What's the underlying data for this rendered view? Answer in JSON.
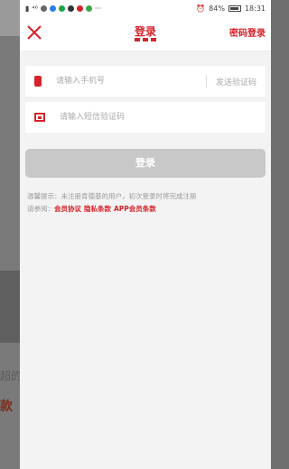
{
  "status_bar": {
    "left_text": "⁴⁶",
    "battery": "84%",
    "time": "18:31"
  },
  "header": {
    "title": "登录",
    "password_login": "密码登录"
  },
  "phone_field": {
    "placeholder": "请输入手机号",
    "send_code_label": "发送验证码"
  },
  "sms_field": {
    "placeholder": "请输入短信验证码"
  },
  "login_button": "登录",
  "tip": "温馨提示：未注册肯德基的用户，初次登录时将完成注册",
  "terms": {
    "prefix": "请参阅：",
    "links": [
      "会员协议",
      "隐私条款",
      "APP会员条款"
    ]
  },
  "background": {
    "text1": "超的",
    "text2": "款"
  },
  "colors": {
    "accent": "#d4232a",
    "button_disabled": "#c8c8c8"
  }
}
